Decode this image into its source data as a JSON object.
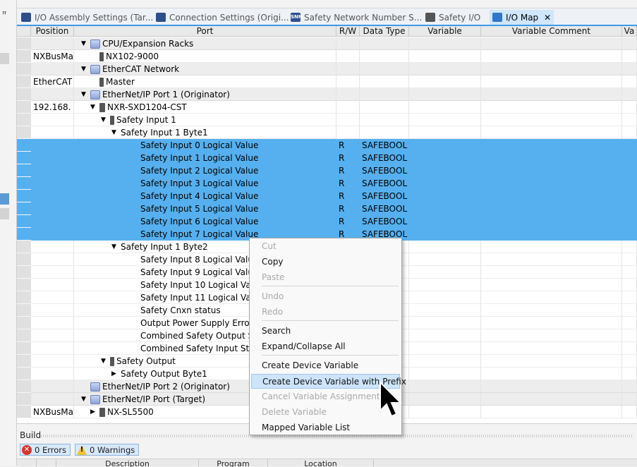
{
  "tabs": [
    {
      "label": "I/O Assembly Settings (Tar...",
      "icon": "device-settings-icon",
      "icon_color": "#2e4f8a",
      "active": false
    },
    {
      "label": "Connection Settings (Origi...",
      "icon": "connection-settings-icon",
      "icon_color": "#2e4f8a",
      "active": false
    },
    {
      "label": "Safety Network Number S...",
      "icon": "snn-icon",
      "icon_text": "SNN",
      "icon_color": "#2e4f8a",
      "active": false
    },
    {
      "label": "Safety I/O",
      "icon": "safety-io-icon",
      "icon_color": "#555555",
      "active": false
    },
    {
      "label": "I/O Map",
      "icon": "io-map-icon",
      "icon_color": "#2f76c8",
      "active": true,
      "close": "✕"
    }
  ],
  "columns": [
    "Position",
    "Port",
    "R/W",
    "Data Type",
    "Variable",
    "Variable Comment",
    "Va"
  ],
  "rows": [
    {
      "position": "",
      "port": "CPU/Expansion Racks",
      "indent": 0,
      "tri": "▼",
      "icon": "rack",
      "rw": "",
      "type": "",
      "group": true,
      "selected": false
    },
    {
      "position": "NXBusMa",
      "port": "NX102-9000",
      "indent": 1,
      "tri": "",
      "icon": "device",
      "rw": "",
      "type": "",
      "group": false,
      "selected": false
    },
    {
      "position": "",
      "port": "EtherCAT Network",
      "indent": 0,
      "tri": "▼",
      "icon": "rack",
      "rw": "",
      "type": "",
      "group": true,
      "selected": false
    },
    {
      "position": "EtherCAT",
      "port": "Master",
      "indent": 1,
      "tri": "",
      "icon": "device",
      "rw": "",
      "type": "",
      "group": false,
      "selected": false
    },
    {
      "position": "",
      "port": "EtherNet/IP Port 1 (Originator)",
      "indent": 0,
      "tri": "▼",
      "icon": "rack",
      "rw": "",
      "type": "",
      "group": true,
      "selected": false
    },
    {
      "position": "192.168.",
      "port": "NXR-SXD1204-CST",
      "indent": 1,
      "tri": "▼",
      "icon": "device2",
      "rw": "",
      "type": "",
      "group": false,
      "selected": false
    },
    {
      "position": "",
      "port": "Safety Input 1",
      "indent": 2,
      "tri": "▼",
      "icon": "device",
      "rw": "",
      "type": "",
      "group": false,
      "selected": false
    },
    {
      "position": "",
      "port": "Safety Input 1 Byte1",
      "indent": 3,
      "tri": "▼",
      "icon": "",
      "rw": "",
      "type": "",
      "group": false,
      "selected": false
    },
    {
      "position": "",
      "port": "Safety Input 0 Logical Value",
      "indent": 4,
      "tri": "",
      "icon": "",
      "rw": "R",
      "type": "SAFEBOOL",
      "group": false,
      "selected": true
    },
    {
      "position": "",
      "port": "Safety Input 1 Logical Value",
      "indent": 4,
      "tri": "",
      "icon": "",
      "rw": "R",
      "type": "SAFEBOOL",
      "group": false,
      "selected": true
    },
    {
      "position": "",
      "port": "Safety Input 2 Logical Value",
      "indent": 4,
      "tri": "",
      "icon": "",
      "rw": "R",
      "type": "SAFEBOOL",
      "group": false,
      "selected": true
    },
    {
      "position": "",
      "port": "Safety Input 3 Logical Value",
      "indent": 4,
      "tri": "",
      "icon": "",
      "rw": "R",
      "type": "SAFEBOOL",
      "group": false,
      "selected": true
    },
    {
      "position": "",
      "port": "Safety Input 4 Logical Value",
      "indent": 4,
      "tri": "",
      "icon": "",
      "rw": "R",
      "type": "SAFEBOOL",
      "group": false,
      "selected": true
    },
    {
      "position": "",
      "port": "Safety Input 5 Logical Value",
      "indent": 4,
      "tri": "",
      "icon": "",
      "rw": "R",
      "type": "SAFEBOOL",
      "group": false,
      "selected": true
    },
    {
      "position": "",
      "port": "Safety Input 6 Logical Value",
      "indent": 4,
      "tri": "",
      "icon": "",
      "rw": "R",
      "type": "SAFEBOOL",
      "group": false,
      "selected": true
    },
    {
      "position": "",
      "port": "Safety Input 7 Logical Value",
      "indent": 4,
      "tri": "",
      "icon": "",
      "rw": "R",
      "type": "SAFEBOOL",
      "group": false,
      "selected": true
    },
    {
      "position": "",
      "port": "Safety Input 1 Byte2",
      "indent": 3,
      "tri": "▼",
      "icon": "",
      "rw": "",
      "type": "",
      "group": false,
      "selected": false
    },
    {
      "position": "",
      "port": "Safety Input 8 Logical Value",
      "indent": 4,
      "tri": "",
      "icon": "",
      "rw": "",
      "type": "",
      "group": false,
      "selected": false
    },
    {
      "position": "",
      "port": "Safety Input 9 Logical Value",
      "indent": 4,
      "tri": "",
      "icon": "",
      "rw": "",
      "type": "",
      "group": false,
      "selected": false
    },
    {
      "position": "",
      "port": "Safety Input 10 Logical Value",
      "indent": 4,
      "tri": "",
      "icon": "",
      "rw": "",
      "type": "",
      "group": false,
      "selected": false
    },
    {
      "position": "",
      "port": "Safety Input 11 Logical Value",
      "indent": 4,
      "tri": "",
      "icon": "",
      "rw": "",
      "type": "",
      "group": false,
      "selected": false
    },
    {
      "position": "",
      "port": "Safety Cnxn status",
      "indent": 4,
      "tri": "",
      "icon": "",
      "rw": "",
      "type": "",
      "group": false,
      "selected": false
    },
    {
      "position": "",
      "port": "Output Power Supply Error Fla",
      "indent": 4,
      "tri": "",
      "icon": "",
      "rw": "",
      "type": "",
      "group": false,
      "selected": false
    },
    {
      "position": "",
      "port": "Combined Safety Output Statu",
      "indent": 4,
      "tri": "",
      "icon": "",
      "rw": "",
      "type": "",
      "group": false,
      "selected": false
    },
    {
      "position": "",
      "port": "Combined Safety Input Status",
      "indent": 4,
      "tri": "",
      "icon": "",
      "rw": "",
      "type": "",
      "group": false,
      "selected": false
    },
    {
      "position": "",
      "port": "Safety Output",
      "indent": 2,
      "tri": "▼",
      "icon": "device",
      "rw": "",
      "type": "",
      "group": false,
      "selected": false
    },
    {
      "position": "",
      "port": "Safety Output Byte1",
      "indent": 3,
      "tri": "▶",
      "icon": "",
      "rw": "",
      "type": "",
      "group": false,
      "selected": false
    },
    {
      "position": "",
      "port": "EtherNet/IP Port 2 (Originator)",
      "indent": 0,
      "tri": "",
      "icon": "rack",
      "rw": "",
      "type": "",
      "group": true,
      "selected": false
    },
    {
      "position": "",
      "port": "EtherNet/IP Port (Target)",
      "indent": 0,
      "tri": "▼",
      "icon": "rack",
      "rw": "",
      "type": "",
      "group": true,
      "selected": false
    },
    {
      "position": "NXBusMa",
      "port": "NX-SL5500",
      "indent": 1,
      "tri": "▶",
      "icon": "device2",
      "rw": "",
      "type": "",
      "group": false,
      "selected": false
    }
  ],
  "context_menu": [
    {
      "label": "Cut",
      "enabled": false
    },
    {
      "label": "Copy",
      "enabled": true
    },
    {
      "label": "Paste",
      "enabled": false
    },
    {
      "sep": true
    },
    {
      "label": "Undo",
      "enabled": false
    },
    {
      "label": "Redo",
      "enabled": false
    },
    {
      "sep": true
    },
    {
      "label": "Search",
      "enabled": true
    },
    {
      "label": "Expand/Collapse All",
      "enabled": true
    },
    {
      "sep": true
    },
    {
      "label": "Create Device Variable",
      "enabled": true
    },
    {
      "label": "Create Device Variable with Prefix",
      "enabled": true,
      "hover": true
    },
    {
      "label": "Cancel Variable Assignment",
      "enabled": false
    },
    {
      "label": "Delete Variable",
      "enabled": false
    },
    {
      "label": "Mapped Variable List",
      "enabled": true
    }
  ],
  "build": {
    "title": "Build",
    "errors": "0  Errors",
    "warnings": "0  Warnings",
    "columns": [
      "Description",
      "Program",
      "Location"
    ]
  },
  "colors": {
    "selection": "#56b0ef",
    "active_tab": "#cfe6fb",
    "menu_hover": "#cde4fb"
  }
}
